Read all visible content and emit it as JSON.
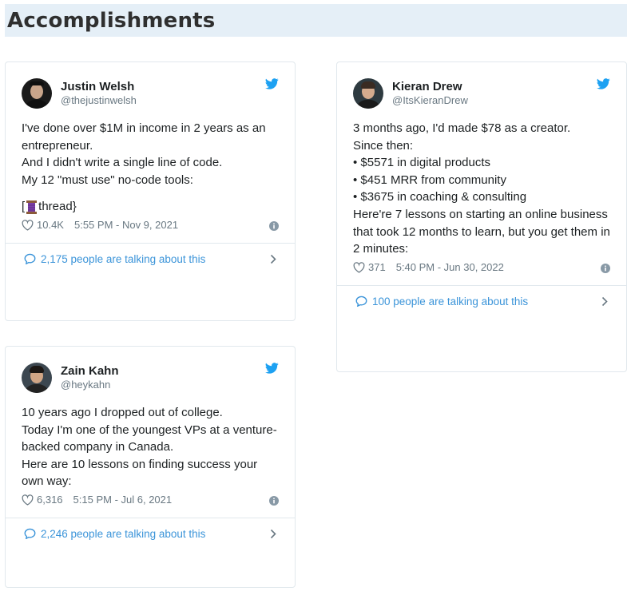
{
  "page": {
    "title": "Accomplishments"
  },
  "tweets": [
    {
      "name": "Justin Welsh",
      "handle": "@thejustinwelsh",
      "lines": [
        "I've done over $1M in income in 2 years as an entrepreneur.",
        "",
        "And I didn't write a single line of code.",
        "",
        "My 12 \"must use\" no-code tools:",
        ""
      ],
      "thread_prefix": "[",
      "thread_suffix": " thread}",
      "likes": "10.4K",
      "time": "5:55 PM - Nov 9, 2021",
      "conversation": "2,175 people are talking about this"
    },
    {
      "name": "Zain Kahn",
      "handle": "@heykahn",
      "lines": [
        "10 years ago I dropped out of college.",
        "",
        "Today I'm one of the youngest VPs at a venture-backed company in Canada.",
        "",
        "Here are 10 lessons on finding success your own way:"
      ],
      "likes": "6,316",
      "time": "5:15 PM - Jul 6, 2021",
      "conversation": "2,246 people are talking about this"
    },
    {
      "name": "Kieran Drew",
      "handle": "@ItsKieranDrew",
      "lines": [
        "3 months ago, I'd made $78 as a creator.",
        "",
        "Since then:",
        "",
        "• $5571 in digital products",
        "• $451 MRR from community",
        "• $3675 in coaching & consulting",
        "",
        "Here're 7 lessons on starting an online business that took 12 months to learn, but you get them in 2 minutes:"
      ],
      "likes": "371",
      "time": "5:40 PM - Jun 30, 2022",
      "conversation": "100 people are talking about this"
    }
  ],
  "colors": {
    "twitter_blue": "#1da1f2",
    "link_blue": "#3b94d9",
    "header_bg": "#e5eff7",
    "muted": "#697882"
  },
  "icons": [
    "twitter-bird-icon",
    "heart-icon",
    "info-icon",
    "speech-bubble-icon",
    "chevron-right-icon",
    "thread-spool-icon"
  ]
}
